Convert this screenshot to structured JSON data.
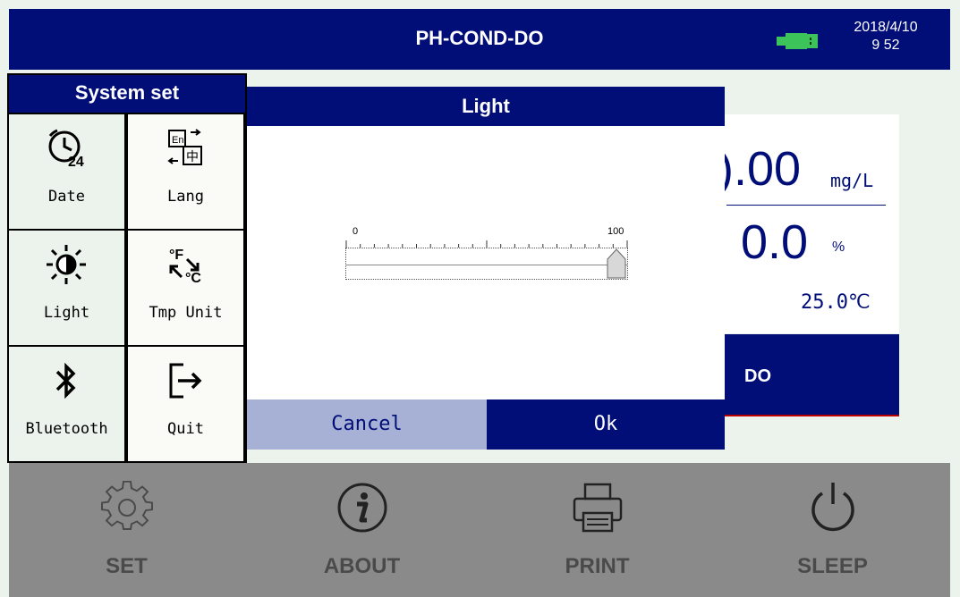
{
  "header": {
    "title": "PH-COND-DO",
    "date": "2018/4/10",
    "time": "9 52",
    "battery_icon": "battery-icon",
    "accent_color": "#010e78"
  },
  "display": {
    "do_value": ").00",
    "do_unit": "mg/L",
    "saturation_value": "0.0",
    "saturation_unit": "%",
    "temperature": "25.0℃",
    "tab_label": "DO"
  },
  "dialog": {
    "title": "Light",
    "slider_min": "0",
    "slider_max": "100",
    "slider_value": 100,
    "cancel_label": "Cancel",
    "ok_label": "Ok"
  },
  "system_set": {
    "title": "System set",
    "items": [
      {
        "label": "Date",
        "icon": "clock-24-icon"
      },
      {
        "label": "Lang",
        "icon": "language-icon"
      },
      {
        "label": "Light",
        "icon": "brightness-icon"
      },
      {
        "label": "Tmp Unit",
        "icon": "temperature-unit-icon"
      },
      {
        "label": "Bluetooth",
        "icon": "bluetooth-icon"
      },
      {
        "label": "Quit",
        "icon": "exit-icon"
      }
    ]
  },
  "bottom_bar": {
    "items": [
      {
        "label": "SET",
        "icon": "gear-icon"
      },
      {
        "label": "ABOUT",
        "icon": "info-icon"
      },
      {
        "label": "PRINT",
        "icon": "printer-icon"
      },
      {
        "label": "SLEEP",
        "icon": "power-icon"
      }
    ]
  }
}
